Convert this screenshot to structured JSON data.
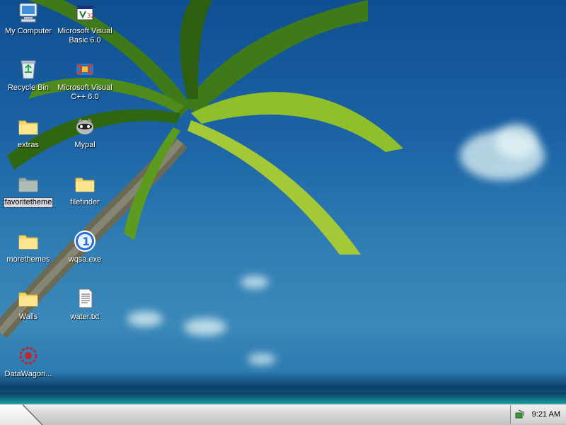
{
  "desktop": {
    "icons": [
      {
        "label": "My Computer",
        "icon": "computer-icon"
      },
      {
        "label": "Microsoft Visual Basic 6.0",
        "icon": "visual-basic-icon"
      },
      {
        "label": "Recycle Bin",
        "icon": "recycle-bin-icon"
      },
      {
        "label": "Microsoft Visual C++ 6.0",
        "icon": "visual-cpp-icon"
      },
      {
        "label": "extras",
        "icon": "folder-icon"
      },
      {
        "label": "Mypal",
        "icon": "mypal-icon"
      },
      {
        "label": "favoritetheme",
        "icon": "folder-icon",
        "selected": true
      },
      {
        "label": "filefinder",
        "icon": "folder-icon"
      },
      {
        "label": "morethemes",
        "icon": "folder-icon"
      },
      {
        "label": "wqsa.exe",
        "icon": "exe-icon"
      },
      {
        "label": "Walls",
        "icon": "folder-icon"
      },
      {
        "label": "water.txt",
        "icon": "text-file-icon"
      },
      {
        "label": "DataWagon...",
        "icon": "datawagon-icon"
      }
    ]
  },
  "taskbar": {
    "clock": "9:21 AM",
    "tray_icon": "network-icon"
  },
  "colors": {
    "sky": "#1c64a6",
    "taskbar": "#d8d8d8",
    "selection": "#d8d8e0"
  }
}
